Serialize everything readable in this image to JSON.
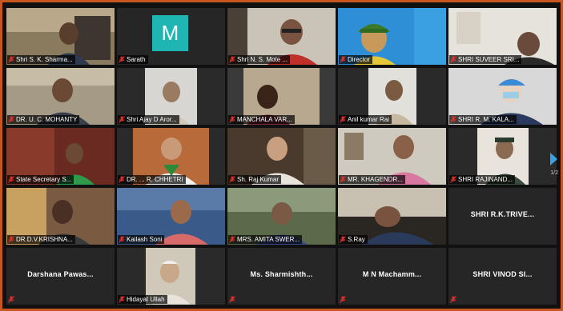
{
  "participants": [
    {
      "name": "Shri S. K. Sharma..."
    },
    {
      "name": "Sarath",
      "avatar_letter": "M"
    },
    {
      "name": "Shri N. S. Mote ..."
    },
    {
      "name": "Director"
    },
    {
      "name": "SHRI SUVEER SRI..."
    },
    {
      "name": "DR. U. C. MOHANTY"
    },
    {
      "name": "Shri Ajay D Aror..."
    },
    {
      "name": "MANCHALA VAR..."
    },
    {
      "name": "Anil kumar Rai"
    },
    {
      "name": "SHRI R. M. KALA..."
    },
    {
      "name": "State Secretary S..."
    },
    {
      "name": "DR. ... R. CHHETRI"
    },
    {
      "name": "Sh. Raj Kumar"
    },
    {
      "name": "MR. KHAGENDR..."
    },
    {
      "name": "SHRI RAJINAND..."
    },
    {
      "name": "DR.D.V.KRISHNA..."
    },
    {
      "name": "Kailash Soni"
    },
    {
      "name": "MRS. AMITA SWER..."
    },
    {
      "name": "S.Ray"
    },
    {
      "name": "SHRI R.K.TRIVE..."
    },
    {
      "name": "Darshana  Pawas..."
    },
    {
      "name": "Hidayat Ullah"
    },
    {
      "name": "Ms.  Sharmishth..."
    },
    {
      "name": "M N  Machamm..."
    },
    {
      "name": "SHRI VINOD SI..."
    }
  ],
  "pager": {
    "page": "1/2"
  },
  "colors": {
    "accent_border": "#c8571f",
    "active_speaker": "#d8e03a",
    "avatar_bg": "#1fb5b3",
    "muted_mic": "#e0302a"
  }
}
